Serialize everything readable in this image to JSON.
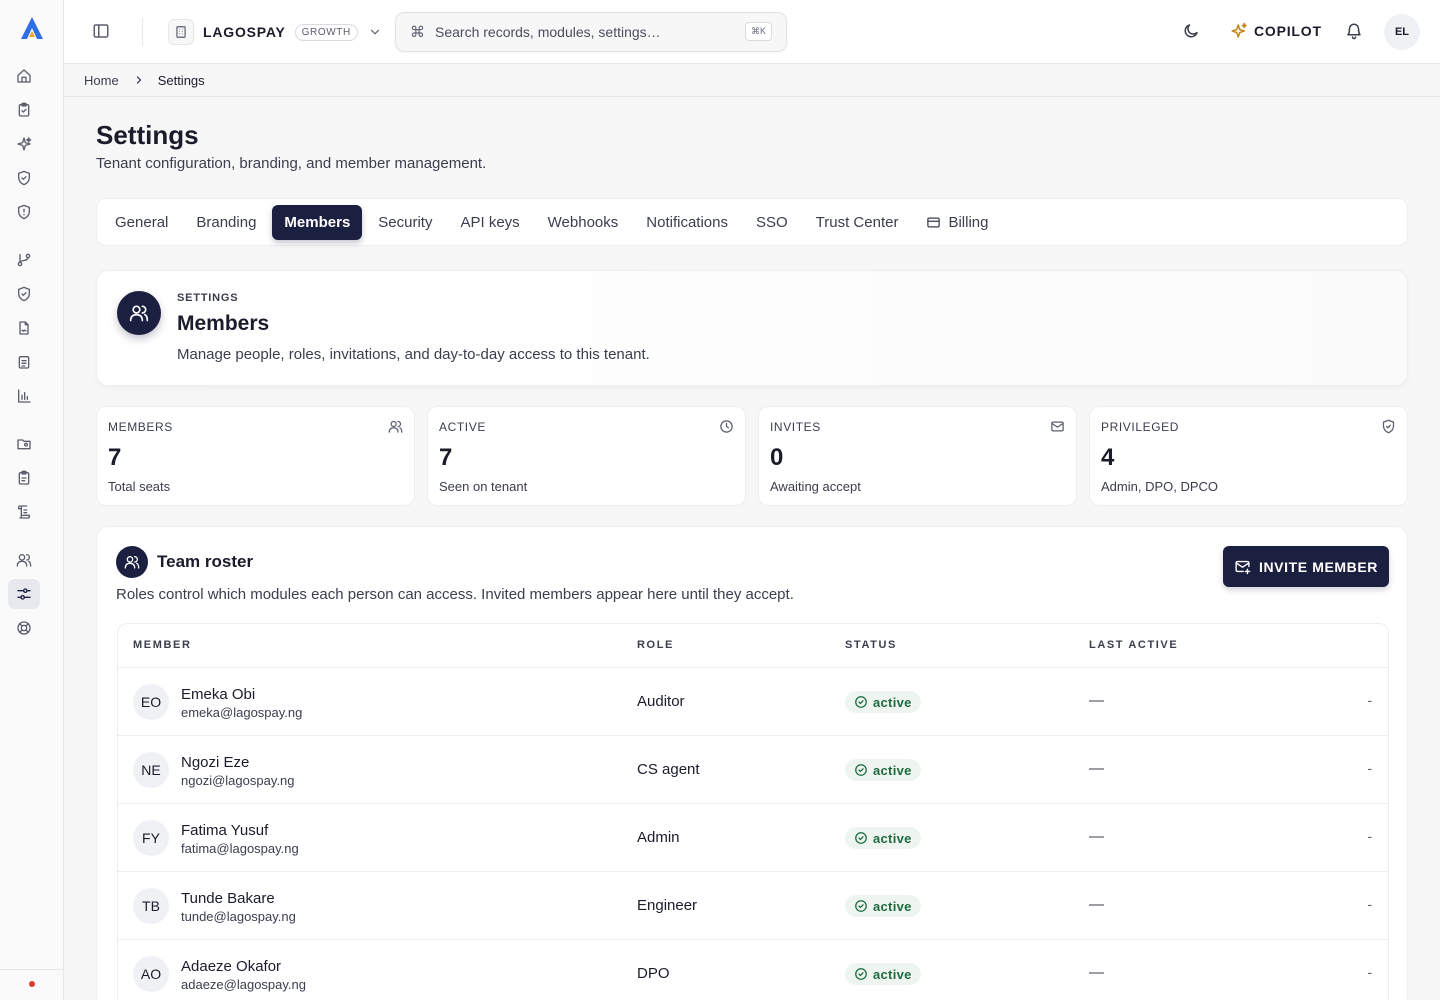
{
  "topbar": {
    "tenant_name": "LAGOSPAY",
    "plan_badge": "GROWTH",
    "search_placeholder": "Search records, modules, settings…",
    "search_shortcut": "⌘K",
    "copilot_label": "COPILOT",
    "user_initials": "EL"
  },
  "breadcrumb": {
    "home": "Home",
    "current": "Settings"
  },
  "page": {
    "title": "Settings",
    "subtitle": "Tenant configuration, branding, and member management."
  },
  "tabs": [
    {
      "label": "General"
    },
    {
      "label": "Branding"
    },
    {
      "label": "Members",
      "active": true
    },
    {
      "label": "Security"
    },
    {
      "label": "API keys"
    },
    {
      "label": "Webhooks"
    },
    {
      "label": "Notifications"
    },
    {
      "label": "SSO"
    },
    {
      "label": "Trust Center"
    },
    {
      "label": "Billing",
      "icon": "credit-card-icon"
    }
  ],
  "section": {
    "eyebrow": "SETTINGS",
    "title": "Members",
    "description": "Manage people, roles, invitations, and day-to-day access to this tenant."
  },
  "stats": [
    {
      "label": "MEMBERS",
      "value": "7",
      "note": "Total seats",
      "icon": "users-icon"
    },
    {
      "label": "ACTIVE",
      "value": "7",
      "note": "Seen on tenant",
      "icon": "clock-icon"
    },
    {
      "label": "INVITES",
      "value": "0",
      "note": "Awaiting accept",
      "icon": "mail-icon"
    },
    {
      "label": "PRIVILEGED",
      "value": "4",
      "note": "Admin, DPO, DPCO",
      "icon": "shield-check-icon"
    }
  ],
  "roster": {
    "title": "Team roster",
    "description": "Roles control which modules each person can access. Invited members appear here until they accept.",
    "invite_label": "INVITE MEMBER",
    "columns": {
      "member": "MEMBER",
      "role": "ROLE",
      "status": "STATUS",
      "last_active": "LAST ACTIVE"
    },
    "members": [
      {
        "initials": "EO",
        "name": "Emeka Obi",
        "email": "emeka@lagospay.ng",
        "role": "Auditor",
        "status": "active",
        "last_active": "—",
        "more": "-"
      },
      {
        "initials": "NE",
        "name": "Ngozi Eze",
        "email": "ngozi@lagospay.ng",
        "role": "CS agent",
        "status": "active",
        "last_active": "—",
        "more": "-"
      },
      {
        "initials": "FY",
        "name": "Fatima Yusuf",
        "email": "fatima@lagospay.ng",
        "role": "Admin",
        "status": "active",
        "last_active": "—",
        "more": "-"
      },
      {
        "initials": "TB",
        "name": "Tunde Bakare",
        "email": "tunde@lagospay.ng",
        "role": "Engineer",
        "status": "active",
        "last_active": "—",
        "more": "-"
      },
      {
        "initials": "AO",
        "name": "Adaeze Okafor",
        "email": "adaeze@lagospay.ng",
        "role": "DPO",
        "status": "active",
        "last_active": "—",
        "more": "-"
      }
    ]
  },
  "colors": {
    "brand_navy": "#1c2040",
    "logo_blue": "#2f6fe4",
    "logo_amber": "#f2a623",
    "status_green": "#1f6b3f",
    "status_bg": "#eef5f0",
    "alert_red": "#dc3b30"
  }
}
